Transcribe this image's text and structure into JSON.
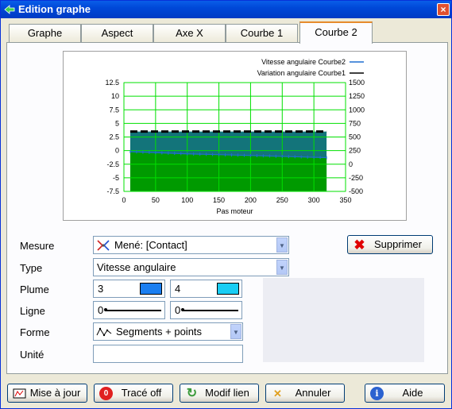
{
  "window": {
    "title": "Edition graphe",
    "close_label": "×"
  },
  "tabs": [
    {
      "label": "Graphe"
    },
    {
      "label": "Aspect"
    },
    {
      "label": "Axe X"
    },
    {
      "label": "Courbe 1"
    },
    {
      "label": "Courbe 2"
    }
  ],
  "active_tab": "Courbe 2",
  "colors": {
    "curve2": "#1f6fd0",
    "fill_top": "#13747a",
    "fill_bottom": "#009a00",
    "grid": "#00e000",
    "swatch1": "#1a7ef0",
    "swatch2": "#19cdf4"
  },
  "chart_data": {
    "type": "area",
    "legend": [
      "Vitesse angulaire Courbe2",
      "Variation angulaire Courbe1"
    ],
    "legend_position": "top-right",
    "xlabel": "Pas moteur",
    "x_ticks": [
      "0",
      "50",
      "100",
      "150",
      "200",
      "250",
      "300",
      "350"
    ],
    "xlim": [
      0,
      350
    ],
    "y_left_ticks": [
      "12.5",
      "10",
      "7.5",
      "5",
      "2.5",
      "0",
      "-2.5",
      "-5",
      "-7.5"
    ],
    "ylim_left": [
      -7.5,
      12.5
    ],
    "y_right_ticks": [
      "1500",
      "1250",
      "1000",
      "750",
      "500",
      "250",
      "0",
      "-250",
      "-500"
    ],
    "ylim_right": [
      -500,
      1500
    ],
    "grid": true,
    "series": [
      {
        "name": "Variation angulaire Courbe1",
        "axis": "left",
        "x": [
          10,
          320
        ],
        "y": [
          3.5,
          3.5
        ]
      },
      {
        "name": "Vitesse angulaire Courbe2",
        "axis": "left",
        "x": [
          10,
          100,
          200,
          320
        ],
        "y": [
          -0.2,
          -0.6,
          -0.9,
          -1.3
        ]
      }
    ]
  },
  "form": {
    "mesure_label": "Mesure",
    "mesure_value": "Mené: [Contact]",
    "type_label": "Type",
    "type_value": "Vitesse angulaire",
    "plume_label": "Plume",
    "plume1": "3",
    "plume2": "4",
    "ligne_label": "Ligne",
    "ligne1": "0",
    "ligne2": "0",
    "forme_label": "Forme",
    "forme_value": "Segments + points",
    "unite_label": "Unité",
    "unite_value": ""
  },
  "buttons": {
    "supprimer": "Supprimer",
    "mise_a_jour": "Mise à jour",
    "trace_off": "Tracé off",
    "modif_lien": "Modif lien",
    "annuler": "Annuler",
    "aide": "Aide"
  }
}
